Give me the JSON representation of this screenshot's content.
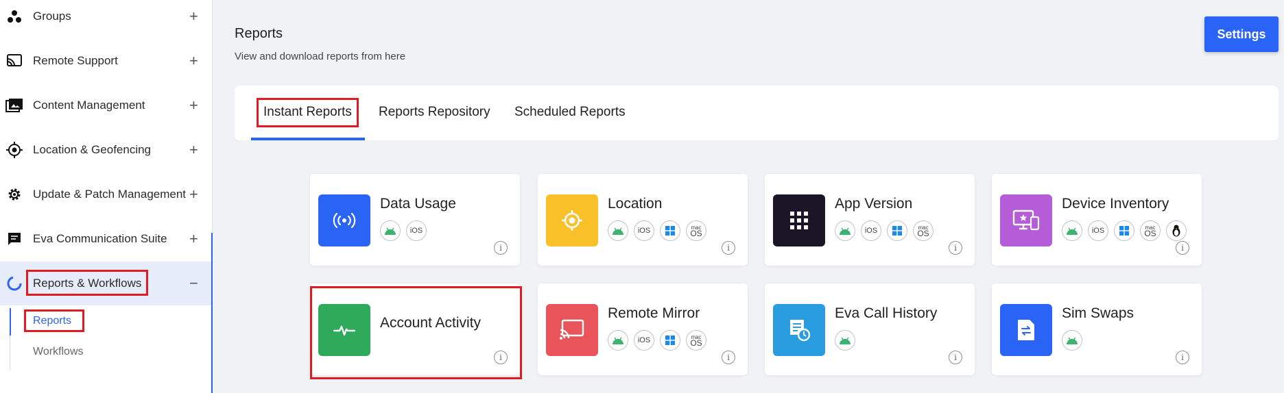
{
  "sidebar": {
    "items": [
      {
        "label": "Groups",
        "toggle": "+"
      },
      {
        "label": "Remote Support",
        "toggle": "+"
      },
      {
        "label": "Content Management",
        "toggle": "+"
      },
      {
        "label": "Location & Geofencing",
        "toggle": "+"
      },
      {
        "label": "Update & Patch Management",
        "toggle": "+"
      },
      {
        "label": "Eva Communication Suite",
        "toggle": "+"
      },
      {
        "label": "Reports & Workflows",
        "toggle": "−"
      }
    ],
    "sub_items": [
      "Reports",
      "Workflows"
    ]
  },
  "header": {
    "title": "Reports",
    "subtitle": "View and download reports from here",
    "settings_label": "Settings"
  },
  "tabs": [
    "Instant Reports",
    "Reports Repository",
    "Scheduled Reports"
  ],
  "platform_labels": {
    "ios": "iOS",
    "mac_top": "mac",
    "mac_bottom": "OS",
    "info": "i"
  },
  "cards": [
    {
      "title": "Data Usage",
      "icon": "broadcast-icon",
      "color": "#2a64f6",
      "platforms": [
        "android",
        "ios"
      ]
    },
    {
      "title": "Location",
      "icon": "location-target-icon",
      "color": "#f9c02a",
      "platforms": [
        "android",
        "ios",
        "windows",
        "macos"
      ]
    },
    {
      "title": "App Version",
      "icon": "app-grid-icon",
      "color": "#1b1528",
      "platforms": [
        "android",
        "ios",
        "windows",
        "macos"
      ]
    },
    {
      "title": "Device Inventory",
      "icon": "device-inventory-icon",
      "color": "#b55cd9",
      "platforms": [
        "android",
        "ios",
        "windows",
        "macos",
        "linux"
      ]
    },
    {
      "title": "Account Activity",
      "icon": "activity-pulse-icon",
      "color": "#2fa95a",
      "platforms": []
    },
    {
      "title": "Remote Mirror",
      "icon": "cast-icon",
      "color": "#e8545a",
      "platforms": [
        "android",
        "ios",
        "windows",
        "macos"
      ]
    },
    {
      "title": "Eva Call History",
      "icon": "call-history-icon",
      "color": "#2a9de0",
      "platforms": [
        "android"
      ]
    },
    {
      "title": "Sim Swaps",
      "icon": "sim-swap-icon",
      "color": "#2a64f6",
      "platforms": [
        "android"
      ]
    }
  ],
  "colors": {
    "accent": "#2a64f6",
    "highlight": "#e21b23",
    "android": "#3cb371",
    "windows": "#1e88e5"
  }
}
